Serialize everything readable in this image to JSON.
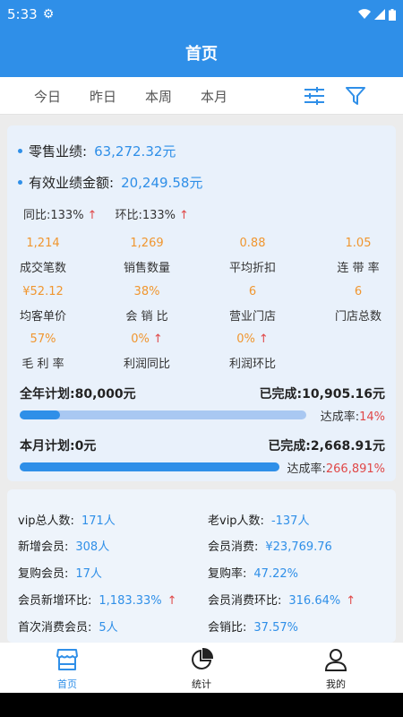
{
  "status": {
    "time": "5:33"
  },
  "header": {
    "title": "首页"
  },
  "periods": [
    "今日",
    "昨日",
    "本周",
    "本月"
  ],
  "sales": {
    "retail_label": "零售业绩:",
    "retail_value": "63,272.32元",
    "effective_label": "有效业绩金额:",
    "effective_value": "20,249.58元",
    "yoy": "同比:133%",
    "mom": "环比:133%"
  },
  "metrics": [
    {
      "value": "1,214",
      "label": "成交笔数"
    },
    {
      "value": "1,269",
      "label": "销售数量"
    },
    {
      "value": "0.88",
      "label": "平均折扣"
    },
    {
      "value": "1.05",
      "label": "连 带 率"
    },
    {
      "value": "¥52.12",
      "label": "均客单价"
    },
    {
      "value": "38%",
      "label": "会 销 比"
    },
    {
      "value": "6",
      "label": "营业门店"
    },
    {
      "value": "6",
      "label": "门店总数"
    },
    {
      "value": "57%",
      "label": "毛 利 率"
    },
    {
      "value": "0%",
      "label": "利润同比"
    },
    {
      "value": "0%",
      "label": "利润环比"
    }
  ],
  "year_plan": {
    "label": "全年计划:80,000元",
    "done": "已完成:10,905.16元",
    "rate_label": "达成率:",
    "rate_value": "14%",
    "progress": 0.14
  },
  "month_plan": {
    "label": "本月计划:0元",
    "done": "已完成:2,668.91元",
    "rate_label": "达成率:",
    "rate_value": "266,891%",
    "progress": 1.0
  },
  "members": {
    "vip_total_label": "vip总人数:",
    "vip_total_value": "171人",
    "old_vip_label": "老vip人数:",
    "old_vip_value": "-137人",
    "new_label": "新增会员:",
    "new_value": "308人",
    "spend_label": "会员消费:",
    "spend_value": "¥23,769.76",
    "repurchase_label": "复购会员:",
    "repurchase_value": "17人",
    "repurchase_rate_label": "复购率:",
    "repurchase_rate_value": "47.22%",
    "new_mom_label": "会员新增环比:",
    "new_mom_value": "1,183.33%",
    "spend_mom_label": "会员消费环比:",
    "spend_mom_value": "316.64%",
    "first_label": "首次消费会员:",
    "first_value": "5人",
    "sales_ratio_label": "会销比:",
    "sales_ratio_value": "37.57%"
  },
  "nav": {
    "home": "首页",
    "stats": "统计",
    "mine": "我的"
  },
  "colors": {
    "primary": "#2f8fe8",
    "orange": "#f0962f",
    "red": "#e04848"
  },
  "icons": {
    "trend_up": "↑"
  }
}
